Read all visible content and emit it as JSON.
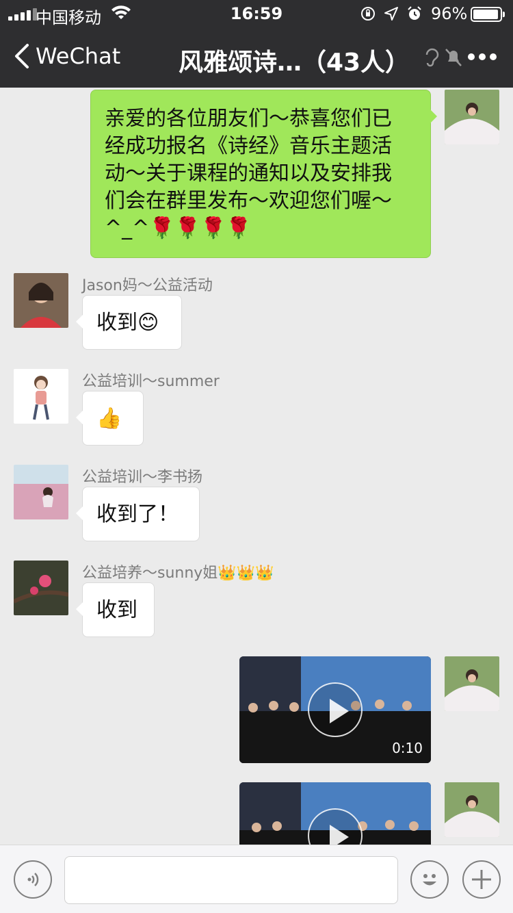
{
  "status_bar": {
    "carrier": "中国移动",
    "time": "16:59",
    "battery_percent": "96%",
    "battery_level": 0.96,
    "icons": [
      "signal-icon",
      "wifi-icon",
      "orientation-lock-icon",
      "location-icon",
      "alarm-icon",
      "battery-icon"
    ]
  },
  "nav": {
    "back_label": "WeChat",
    "title": "风雅颂诗…（43人）",
    "icons": [
      "hearing-icon",
      "mute-icon",
      "more-icon"
    ]
  },
  "messages": [
    {
      "side": "right",
      "type": "text",
      "lines": [
        "亲爱的各位朋友们～恭喜您们已",
        "经成功报名《诗经》音乐主题活",
        "动～关于课程的通知以及安排我",
        "们会在群里发布～欢迎您们喔～",
        "^_^🌹🌹🌹🌹"
      ]
    },
    {
      "side": "left",
      "sender": "Jason妈～公益活动",
      "type": "text",
      "text": "收到😊"
    },
    {
      "side": "left",
      "sender": "公益培训～summer",
      "type": "text",
      "text": "👍"
    },
    {
      "side": "left",
      "sender": "公益培训～李书扬",
      "type": "text",
      "text": "收到了！"
    },
    {
      "side": "left",
      "sender": "公益培养～sunny姐👑👑👑",
      "type": "text",
      "text": "收到"
    },
    {
      "side": "right",
      "type": "video",
      "duration": "0:10"
    },
    {
      "side": "right",
      "type": "video",
      "duration": ""
    }
  ],
  "input_bar": {
    "placeholder": "",
    "icons": [
      "voice-icon",
      "emoji-icon",
      "plus-icon"
    ]
  },
  "colors": {
    "nav_bg": "#2e2e30",
    "chat_bg": "#ebebeb",
    "bubble_green": "#a0e75a",
    "bubble_white": "#ffffff"
  }
}
